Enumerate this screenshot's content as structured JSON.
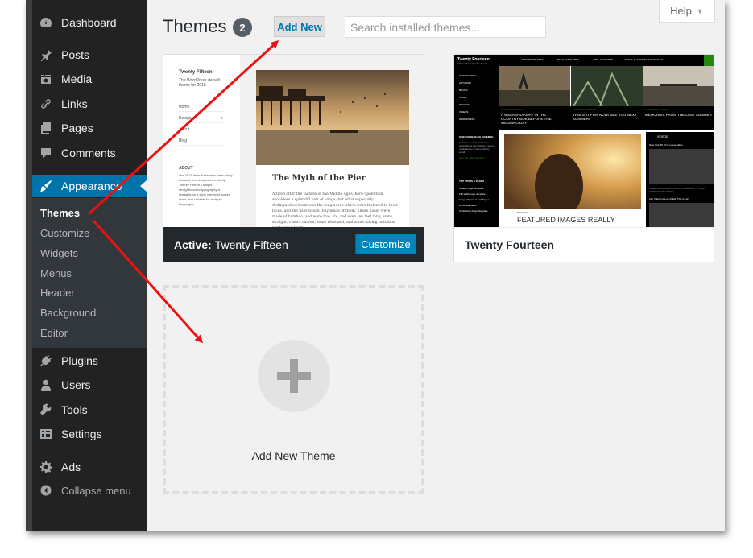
{
  "sidebar": {
    "items": [
      {
        "label": "Dashboard",
        "icon": "dashboard-icon"
      },
      {
        "label": "Posts",
        "icon": "pin-icon"
      },
      {
        "label": "Media",
        "icon": "media-icon"
      },
      {
        "label": "Links",
        "icon": "link-icon"
      },
      {
        "label": "Pages",
        "icon": "pages-icon"
      },
      {
        "label": "Comments",
        "icon": "comment-icon"
      },
      {
        "label": "Appearance",
        "icon": "paintbrush-icon"
      },
      {
        "label": "Plugins",
        "icon": "plug-icon"
      },
      {
        "label": "Users",
        "icon": "user-icon"
      },
      {
        "label": "Tools",
        "icon": "wrench-icon"
      },
      {
        "label": "Settings",
        "icon": "settings-icon"
      },
      {
        "label": "Ads",
        "icon": "gear-icon"
      }
    ],
    "submenu": [
      "Themes",
      "Customize",
      "Widgets",
      "Menus",
      "Header",
      "Background",
      "Editor"
    ],
    "collapse": "Collapse menu"
  },
  "header": {
    "title": "Themes",
    "count": "2",
    "add_new": "Add New",
    "search_placeholder": "Search installed themes...",
    "help": "Help"
  },
  "themes": [
    {
      "active_prefix": "Active:",
      "name": "Twenty Fifteen",
      "customize": "Customize",
      "preview": {
        "site_title": "Twenty Fifteen",
        "tagline": "The WordPress default theme for 2015.",
        "menu": [
          "Home",
          "Design",
          "About",
          "Blog"
        ],
        "about_heading": "ABOUT",
        "about_text": "Our 2015 default theme is clean, blog-focused, and designed for clarity. Twenty Fifteen's simple, straightforward typography is readable on a wide variety of screen sizes, and suitable for multiple languages.",
        "post_title": "The Myth of the Pier",
        "post_text": "Attired after the fashion of the Middle Ages, here upon their shoulders a splendid pair of wings; but what especially distinguished them was the long noses which were fastened to their faces, and the uses which they made of them. These noses were made of bamboo, and were five, six, and even ten feet long, some straight, others curved, some ribboned, and some having imitation warts upon them."
      }
    },
    {
      "name": "Twenty Fourteen",
      "preview": {
        "site_title": "Twenty Fourteen",
        "tagline": "A beautiful magazine theme",
        "nav": [
          "DROPDOWN MENU",
          "PAGE TEMPLATES",
          "HTML ELEMENTS",
          "IMAGE ALIGNMENT AND STYLES"
        ],
        "left_menu": [
          "IS POST MENU",
          "ARTWORK",
          "BOOKS",
          "MUSIC",
          "PHOTOS",
          "VIDEOS",
          "WORDPRESS"
        ],
        "left_blurb_title": "SUBSCRIBE BLOG VIA EMAIL",
        "left_blurb": "Enter your email address to subscribe to this blog and receive notifications of new posts by email.",
        "left_followers": "Join 334 other followers",
        "left_pages_title": "TOP POSTS & PAGES",
        "left_pages": [
          "Default Page Template",
          "Full width page template",
          "Image Alignment and Styles",
          "HTML Elements",
          "Contributor Page Template"
        ],
        "cards": [
          {
            "cat": "FEATURED, TRAVEL",
            "title": "A WEEKEND AWAY IN THE COUNTRYSIDE BEFORE THE WEDDING DAY"
          },
          {
            "cat": "FEATURED, NATURE",
            "title": "THIS IS IT FOR NOW! SEE YOU NEXT SUMMER!"
          },
          {
            "cat": "FEATURED, TRAVEL",
            "title": "MEMORIES FROM THE LAST SUMMER"
          }
        ],
        "feature_cat": "PHOTOS",
        "feature_title": "FEATURED IMAGES REALLY",
        "videos_heading": "VIDEOS",
        "video_title": "New York 4K Time Lapse video",
        "video_meta": "VIDEO DAVIDWORDPRESS · FEBRUARY 11, 2014 · KENNETH DELGADO",
        "video2_title": "Ash Vukcevnya on ATEH: This Is Us?"
      }
    }
  ],
  "add_new_theme": "Add New Theme",
  "colors": {
    "accent": "#0073aa",
    "sidebar": "#222222",
    "annotation": "#ee1111"
  }
}
